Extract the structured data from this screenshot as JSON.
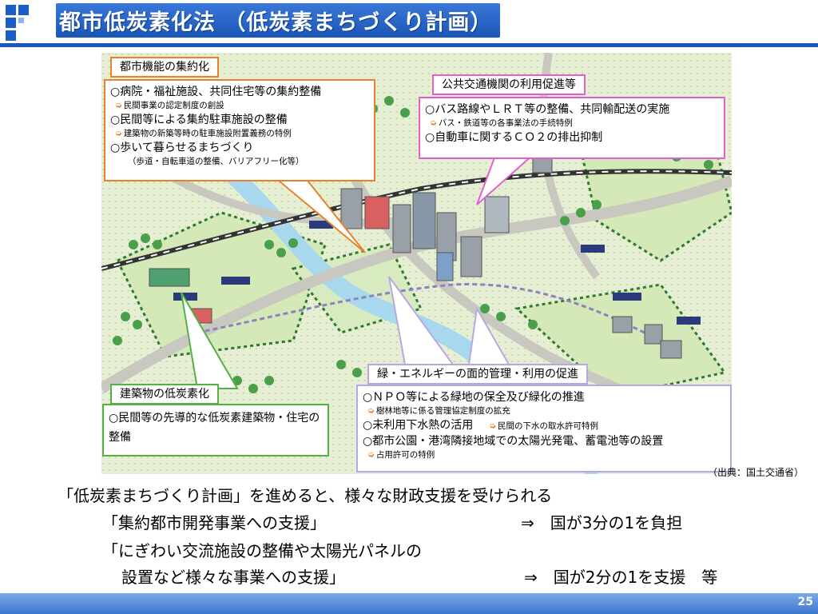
{
  "title": "都市低炭素化法 （低炭素まちづくり計画）",
  "boxes": {
    "compact": {
      "label": "都市機能の集約化",
      "items": [
        {
          "text": "病院・福祉施設、共同住宅等の集約整備",
          "sub": "民間事業の認定制度の創設"
        },
        {
          "text": "民間等による集約駐車施設の整備",
          "sub": "建築物の新築等時の駐車施設附置義務の特例"
        },
        {
          "text": "歩いて暮らせるまちづくり",
          "sub": "（歩道・自転車道の整備、バリアフリー化等）"
        }
      ]
    },
    "transit": {
      "label": "公共交通機関の利用促進等",
      "items": [
        {
          "text": "バス路線やＬＲＴ等の整備、共同輸配送の実施",
          "sub": "バス・鉄道等の各事業法の手続特例"
        },
        {
          "text": "自動車に関するＣＯ２の排出抑制",
          "sub": ""
        }
      ]
    },
    "building": {
      "label": "建築物の低炭素化",
      "items": [
        {
          "text": "民間等の先導的な低炭素建築物・住宅の整備",
          "sub": ""
        }
      ]
    },
    "green": {
      "label": "緑・エネルギーの面的管理・利用の促進",
      "items": [
        {
          "text": "ＮＰＯ等による緑地の保全及び緑化の推進",
          "sub": "樹林地等に係る管理協定制度の拡充"
        },
        {
          "text": "未利用下水熱の活用",
          "sub": "民間の下水の取水許可特例"
        },
        {
          "text": "都市公園・港湾隣接地域での太陽光発電、蓄電池等の設置",
          "sub": "占用許可の特例"
        }
      ]
    }
  },
  "source": "（出典：国土交通省）",
  "summary": {
    "line1": "「低炭素まちづくり計画」を進めると、様々な財政支援を受けられる",
    "line2_left": "「集約都市開発事業への支援」",
    "line2_right": "⇒　国が3分の1を負担",
    "line3": "「にぎわい交流施設の整備や太陽光パネルの",
    "line4_left": "設置など様々な事業への支援」",
    "line4_right": "⇒　国が2分の1を支援　等"
  },
  "page_number": "25",
  "colors": {
    "brand": "#1a55c0",
    "compact_border": "#e8822a",
    "transit_border": "#e060d0",
    "building_border": "#55b048",
    "green_border": "#b8a8e0",
    "sub_arrow": "#e07010"
  }
}
